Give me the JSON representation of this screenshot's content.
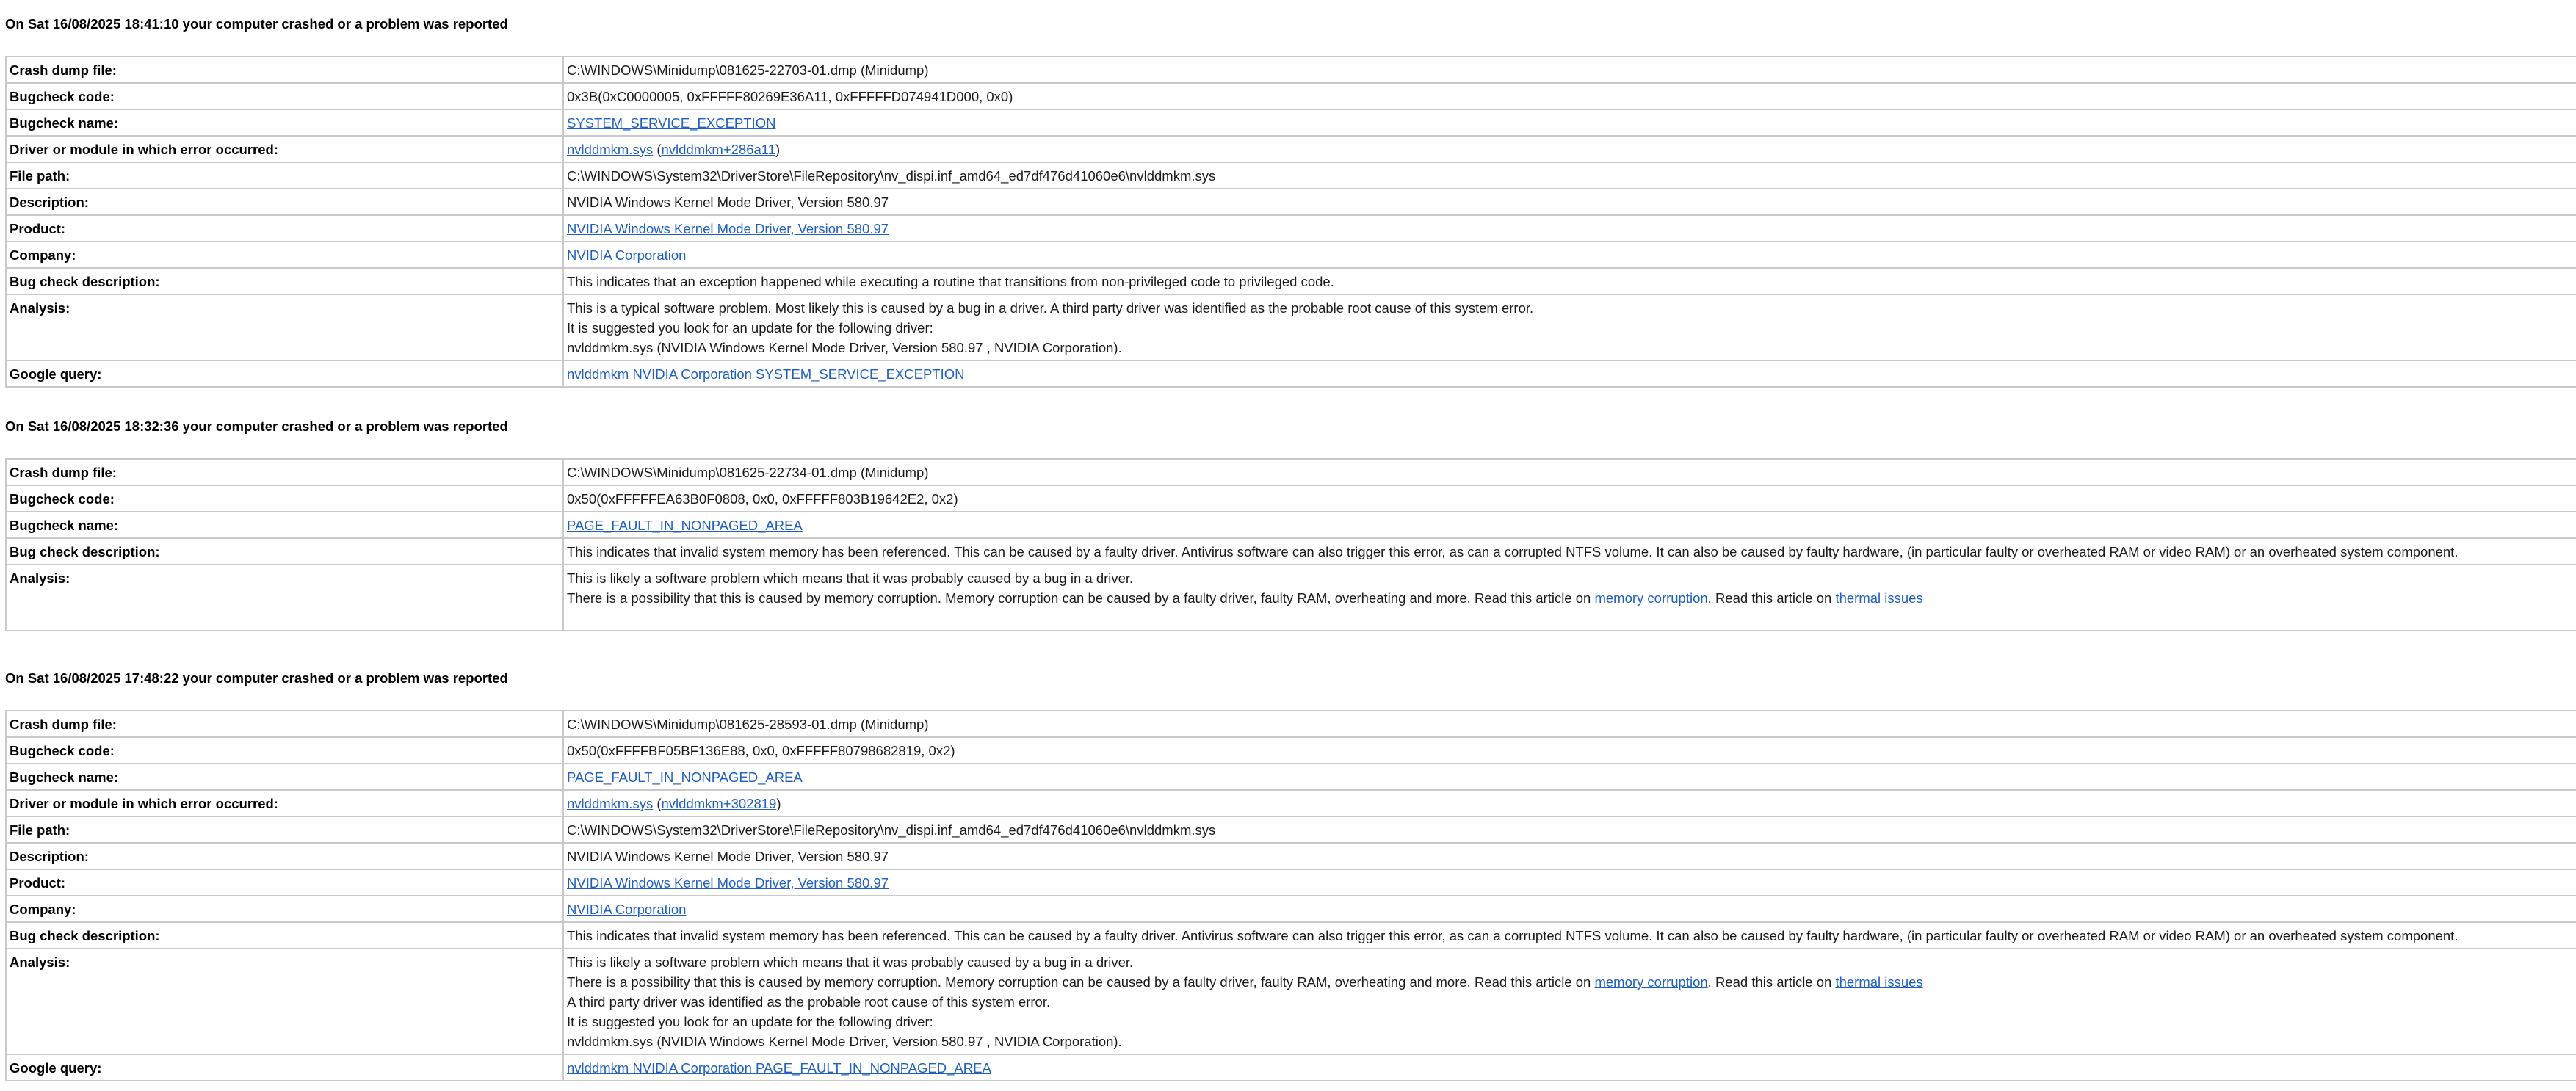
{
  "crashes": [
    {
      "heading": "On Sat 16/08/2025 18:41:10 your computer crashed or a problem was reported",
      "rows": {
        "dump_label": "Crash dump file:",
        "dump_value": "C:\\WINDOWS\\Minidump\\081625-22703-01.dmp (Minidump)",
        "code_label": "Bugcheck code:",
        "code_value": "0x3B(0xC0000005, 0xFFFFF80269E36A11, 0xFFFFFD074941D000, 0x0)",
        "name_label": "Bugcheck name:",
        "name_value": "SYSTEM_SERVICE_EXCEPTION",
        "driver_label": "Driver or module in which error occurred:",
        "driver_link": "nvlddmkm.sys",
        "driver_sep_open": " (",
        "driver_offset_link": "nvlddmkm+286a11",
        "driver_sep_close": ")",
        "path_label": "File path:",
        "path_value": "C:\\WINDOWS\\System32\\DriverStore\\FileRepository\\nv_dispi.inf_amd64_ed7df476d41060e6\\nvlddmkm.sys",
        "desc_label": "Description:",
        "desc_value": "NVIDIA Windows Kernel Mode Driver, Version 580.97",
        "product_label": "Product:",
        "product_value": "NVIDIA Windows Kernel Mode Driver, Version 580.97",
        "company_label": "Company:",
        "company_value": "NVIDIA Corporation",
        "bugdesc_label": "Bug check description:",
        "bugdesc_value": "This indicates that an exception happened while executing a routine that transitions from non-privileged code to privileged code.",
        "analysis_label": "Analysis:",
        "analysis_lines": [
          "This is a typical software problem. Most likely this is caused by a bug in a driver. A third party driver was identified as the probable root cause of this system error.",
          "It is suggested you look for an update for the following driver:",
          "nvlddmkm.sys (NVIDIA Windows Kernel Mode Driver, Version 580.97 , NVIDIA Corporation)."
        ],
        "google_label": "Google query:",
        "google_value": "nvlddmkm NVIDIA Corporation SYSTEM_SERVICE_EXCEPTION"
      }
    },
    {
      "heading": "On Sat 16/08/2025 18:32:36 your computer crashed or a problem was reported",
      "rows": {
        "dump_label": "Crash dump file:",
        "dump_value": "C:\\WINDOWS\\Minidump\\081625-22734-01.dmp (Minidump)",
        "code_label": "Bugcheck code:",
        "code_value": "0x50(0xFFFFFEA63B0F0808, 0x0, 0xFFFFF803B19642E2, 0x2)",
        "name_label": "Bugcheck name:",
        "name_value": "PAGE_FAULT_IN_NONPAGED_AREA",
        "bugdesc_label": "Bug check description:",
        "bugdesc_value": "This indicates that invalid system memory has been referenced. This can be caused by a faulty driver. Antivirus software can also trigger this error, as can a corrupted NTFS volume. It can also be caused by faulty hardware, (in particular faulty or overheated RAM or video RAM) or an overheated system component.",
        "analysis_label": "Analysis:",
        "analysis_line1": "This is likely a software problem which means that it was probably caused by a bug in a driver.",
        "analysis_line2_pre": "There is a possibility that this is caused by memory corruption. Memory corruption can be caused by a faulty driver, faulty RAM, overheating and more. Read this article on ",
        "analysis_link1": "memory corruption",
        "analysis_line2_mid": ". Read this article on ",
        "analysis_link2": "thermal issues"
      }
    },
    {
      "heading": "On Sat 16/08/2025 17:48:22 your computer crashed or a problem was reported",
      "rows": {
        "dump_label": "Crash dump file:",
        "dump_value": "C:\\WINDOWS\\Minidump\\081625-28593-01.dmp (Minidump)",
        "code_label": "Bugcheck code:",
        "code_value": "0x50(0xFFFFBF05BF136E88, 0x0, 0xFFFFF80798682819, 0x2)",
        "name_label": "Bugcheck name:",
        "name_value": "PAGE_FAULT_IN_NONPAGED_AREA",
        "driver_label": "Driver or module in which error occurred:",
        "driver_link": "nvlddmkm.sys",
        "driver_sep_open": " (",
        "driver_offset_link": "nvlddmkm+302819",
        "driver_sep_close": ")",
        "path_label": "File path:",
        "path_value": "C:\\WINDOWS\\System32\\DriverStore\\FileRepository\\nv_dispi.inf_amd64_ed7df476d41060e6\\nvlddmkm.sys",
        "desc_label": "Description:",
        "desc_value": "NVIDIA Windows Kernel Mode Driver, Version 580.97",
        "product_label": "Product:",
        "product_value": "NVIDIA Windows Kernel Mode Driver, Version 580.97",
        "company_label": "Company:",
        "company_value": "NVIDIA Corporation",
        "bugdesc_label": "Bug check description:",
        "bugdesc_value": "This indicates that invalid system memory has been referenced. This can be caused by a faulty driver. Antivirus software can also trigger this error, as can a corrupted NTFS volume. It can also be caused by faulty hardware, (in particular faulty or overheated RAM or video RAM) or an overheated system component.",
        "analysis_label": "Analysis:",
        "analysis_line1": "This is likely a software problem which means that it was probably caused by a bug in a driver.",
        "analysis_line2_pre": "There is a possibility that this is caused by memory corruption. Memory corruption can be caused by a faulty driver, faulty RAM, overheating and more. Read this article on ",
        "analysis_link1": "memory corruption",
        "analysis_line2_mid": ". Read this article on ",
        "analysis_link2": "thermal issues",
        "analysis_lines_after": [
          "A third party driver was identified as the probable root cause of this system error.",
          "It is suggested you look for an update for the following driver:",
          "nvlddmkm.sys (NVIDIA Windows Kernel Mode Driver, Version 580.97 , NVIDIA Corporation)."
        ],
        "google_label": "Google query:",
        "google_value": "nvlddmkm NVIDIA Corporation PAGE_FAULT_IN_NONPAGED_AREA"
      }
    }
  ],
  "colors": {
    "link": "#1f5fbf",
    "border": "#c9c9c9",
    "text": "#000000"
  }
}
